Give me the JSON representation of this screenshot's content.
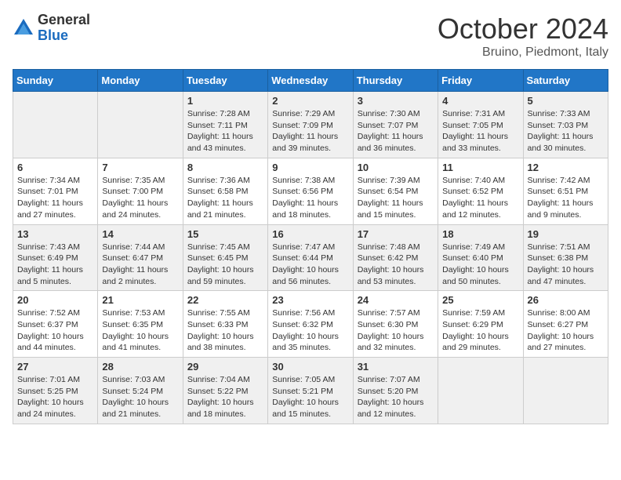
{
  "header": {
    "logo_general": "General",
    "logo_blue": "Blue",
    "title": "October 2024",
    "location": "Bruino, Piedmont, Italy"
  },
  "days_of_week": [
    "Sunday",
    "Monday",
    "Tuesday",
    "Wednesday",
    "Thursday",
    "Friday",
    "Saturday"
  ],
  "weeks": [
    [
      {
        "day": "",
        "info": ""
      },
      {
        "day": "",
        "info": ""
      },
      {
        "day": "1",
        "info": "Sunrise: 7:28 AM\nSunset: 7:11 PM\nDaylight: 11 hours and 43 minutes."
      },
      {
        "day": "2",
        "info": "Sunrise: 7:29 AM\nSunset: 7:09 PM\nDaylight: 11 hours and 39 minutes."
      },
      {
        "day": "3",
        "info": "Sunrise: 7:30 AM\nSunset: 7:07 PM\nDaylight: 11 hours and 36 minutes."
      },
      {
        "day": "4",
        "info": "Sunrise: 7:31 AM\nSunset: 7:05 PM\nDaylight: 11 hours and 33 minutes."
      },
      {
        "day": "5",
        "info": "Sunrise: 7:33 AM\nSunset: 7:03 PM\nDaylight: 11 hours and 30 minutes."
      }
    ],
    [
      {
        "day": "6",
        "info": "Sunrise: 7:34 AM\nSunset: 7:01 PM\nDaylight: 11 hours and 27 minutes."
      },
      {
        "day": "7",
        "info": "Sunrise: 7:35 AM\nSunset: 7:00 PM\nDaylight: 11 hours and 24 minutes."
      },
      {
        "day": "8",
        "info": "Sunrise: 7:36 AM\nSunset: 6:58 PM\nDaylight: 11 hours and 21 minutes."
      },
      {
        "day": "9",
        "info": "Sunrise: 7:38 AM\nSunset: 6:56 PM\nDaylight: 11 hours and 18 minutes."
      },
      {
        "day": "10",
        "info": "Sunrise: 7:39 AM\nSunset: 6:54 PM\nDaylight: 11 hours and 15 minutes."
      },
      {
        "day": "11",
        "info": "Sunrise: 7:40 AM\nSunset: 6:52 PM\nDaylight: 11 hours and 12 minutes."
      },
      {
        "day": "12",
        "info": "Sunrise: 7:42 AM\nSunset: 6:51 PM\nDaylight: 11 hours and 9 minutes."
      }
    ],
    [
      {
        "day": "13",
        "info": "Sunrise: 7:43 AM\nSunset: 6:49 PM\nDaylight: 11 hours and 5 minutes."
      },
      {
        "day": "14",
        "info": "Sunrise: 7:44 AM\nSunset: 6:47 PM\nDaylight: 11 hours and 2 minutes."
      },
      {
        "day": "15",
        "info": "Sunrise: 7:45 AM\nSunset: 6:45 PM\nDaylight: 10 hours and 59 minutes."
      },
      {
        "day": "16",
        "info": "Sunrise: 7:47 AM\nSunset: 6:44 PM\nDaylight: 10 hours and 56 minutes."
      },
      {
        "day": "17",
        "info": "Sunrise: 7:48 AM\nSunset: 6:42 PM\nDaylight: 10 hours and 53 minutes."
      },
      {
        "day": "18",
        "info": "Sunrise: 7:49 AM\nSunset: 6:40 PM\nDaylight: 10 hours and 50 minutes."
      },
      {
        "day": "19",
        "info": "Sunrise: 7:51 AM\nSunset: 6:38 PM\nDaylight: 10 hours and 47 minutes."
      }
    ],
    [
      {
        "day": "20",
        "info": "Sunrise: 7:52 AM\nSunset: 6:37 PM\nDaylight: 10 hours and 44 minutes."
      },
      {
        "day": "21",
        "info": "Sunrise: 7:53 AM\nSunset: 6:35 PM\nDaylight: 10 hours and 41 minutes."
      },
      {
        "day": "22",
        "info": "Sunrise: 7:55 AM\nSunset: 6:33 PM\nDaylight: 10 hours and 38 minutes."
      },
      {
        "day": "23",
        "info": "Sunrise: 7:56 AM\nSunset: 6:32 PM\nDaylight: 10 hours and 35 minutes."
      },
      {
        "day": "24",
        "info": "Sunrise: 7:57 AM\nSunset: 6:30 PM\nDaylight: 10 hours and 32 minutes."
      },
      {
        "day": "25",
        "info": "Sunrise: 7:59 AM\nSunset: 6:29 PM\nDaylight: 10 hours and 29 minutes."
      },
      {
        "day": "26",
        "info": "Sunrise: 8:00 AM\nSunset: 6:27 PM\nDaylight: 10 hours and 27 minutes."
      }
    ],
    [
      {
        "day": "27",
        "info": "Sunrise: 7:01 AM\nSunset: 5:25 PM\nDaylight: 10 hours and 24 minutes."
      },
      {
        "day": "28",
        "info": "Sunrise: 7:03 AM\nSunset: 5:24 PM\nDaylight: 10 hours and 21 minutes."
      },
      {
        "day": "29",
        "info": "Sunrise: 7:04 AM\nSunset: 5:22 PM\nDaylight: 10 hours and 18 minutes."
      },
      {
        "day": "30",
        "info": "Sunrise: 7:05 AM\nSunset: 5:21 PM\nDaylight: 10 hours and 15 minutes."
      },
      {
        "day": "31",
        "info": "Sunrise: 7:07 AM\nSunset: 5:20 PM\nDaylight: 10 hours and 12 minutes."
      },
      {
        "day": "",
        "info": ""
      },
      {
        "day": "",
        "info": ""
      }
    ]
  ]
}
